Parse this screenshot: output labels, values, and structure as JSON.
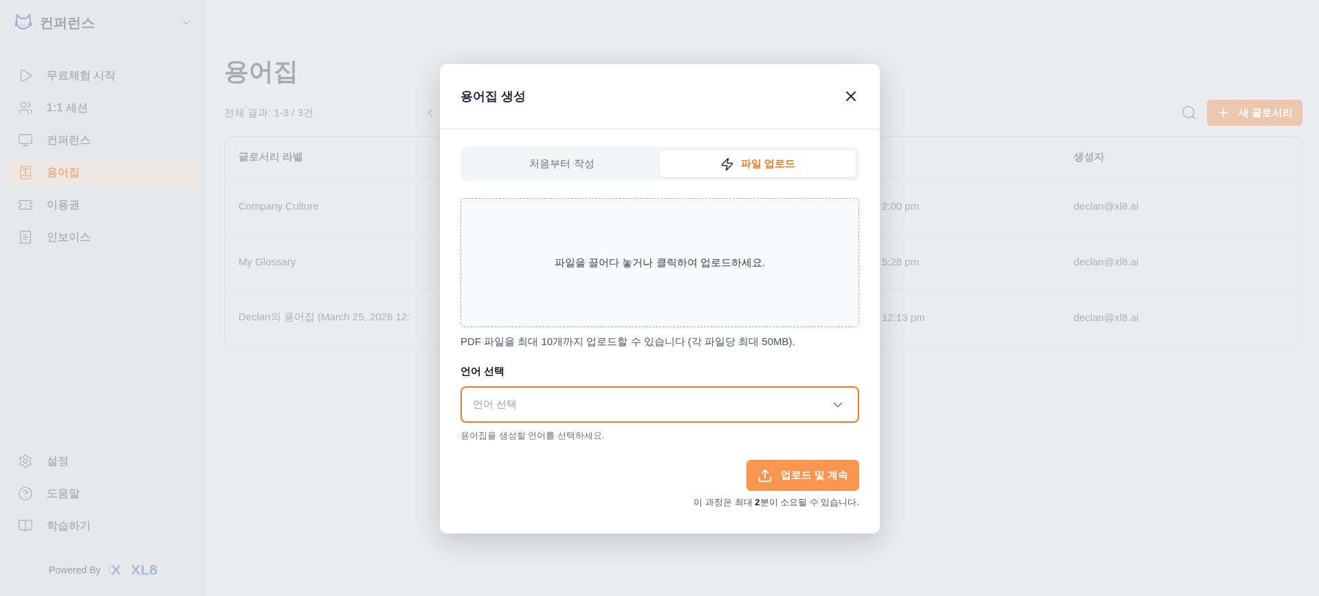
{
  "sidebar": {
    "workspace": "컨퍼런스",
    "items": [
      {
        "label": "무료체험 시작",
        "selected": false
      },
      {
        "label": "1:1 세션",
        "selected": false
      },
      {
        "label": "컨퍼런스",
        "selected": false
      },
      {
        "label": "용어집",
        "selected": true
      },
      {
        "label": "이용권",
        "selected": false
      },
      {
        "label": "인보이스",
        "selected": false
      }
    ],
    "bottom_items": [
      {
        "label": "설정"
      },
      {
        "label": "도움말"
      },
      {
        "label": "학습하기"
      }
    ],
    "powered_by": "Powered By",
    "brand": "XL8"
  },
  "page": {
    "title": "용어집",
    "result_count": "전체 결과: 1-3 / 3건",
    "new_button": "새 글로서리"
  },
  "table": {
    "columns": [
      "글로서리 라벨",
      "생성자"
    ],
    "rows": [
      {
        "label": "Company Culture",
        "column_2": "2:00 pm",
        "creator": "declan@xl8.ai"
      },
      {
        "label": "My Glossary",
        "column_2": "5:28 pm",
        "creator": "declan@xl8.ai"
      },
      {
        "label": "Declan의 용어집 (March 25, 2026 12:",
        "column_2": "12:13 pm",
        "creator": "declan@xl8.ai"
      }
    ]
  },
  "dialog": {
    "title": "용어집 생성",
    "tabs": [
      {
        "label": "처음부터 작성",
        "kind": "text",
        "selected": false
      },
      {
        "label": "파일 업로드",
        "kind": "file",
        "selected": true
      }
    ],
    "dropzone": "파일을 끌어다 놓거나 클릭하여 업로드하세요.",
    "limit_note": "PDF 파일을 최대 10개까지 업로드할 수 있습니다 (각 파일당 최대 50MB).",
    "language_label": "언어 선택",
    "language_select": {
      "placeholder": "언어 선택",
      "focused": true
    },
    "language_hint": "용어집을 생성할 언어를 선택하세요.",
    "submit_button": "업로드 및 계속",
    "time_note": "이 과정은 최대 **2**분이 소요될 수 있습니다."
  }
}
